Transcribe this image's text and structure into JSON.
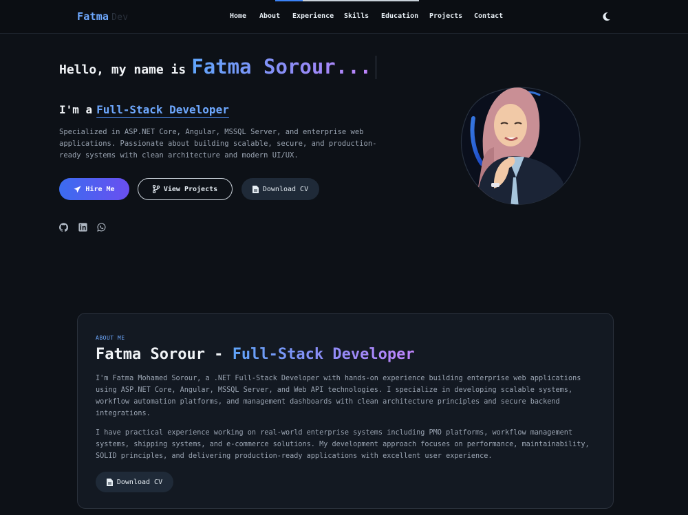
{
  "nav": {
    "logo_main": "Fatma",
    "logo_sub": "Dev",
    "links": [
      "Home",
      "About",
      "Experience",
      "Skills",
      "Education",
      "Projects",
      "Contact"
    ],
    "theme_icon": "moon-icon"
  },
  "hero": {
    "greeting": "Hello, my name is",
    "name": "Fatma Sorour...",
    "role_prefix": "I'm a",
    "role": "Full-Stack Developer",
    "intro": "Specialized in ASP.NET Core, Angular, MSSQL Server, and enterprise web applications. Passionate about building scalable, secure, and production-ready systems with clean architecture and modern UI/UX.",
    "buttons": {
      "hire": "Hire Me",
      "projects": "View Projects",
      "cv": "Download CV"
    },
    "socials": [
      "github-icon",
      "linkedin-icon",
      "whatsapp-icon"
    ]
  },
  "about": {
    "eyebrow": "ABOUT ME",
    "heading_name": "Fatma Sorour - ",
    "heading_role": "Full-Stack Developer",
    "paragraph1": "I'm Fatma Mohamed Sorour, a .NET Full-Stack Developer with hands-on experience building enterprise web applications using ASP.NET Core, Angular, MSSQL Server, and Web API technologies. I specialize in developing scalable systems, workflow automation platforms, and management dashboards with clean architecture principles and secure backend integrations.",
    "paragraph2": "I have practical experience working on real-world enterprise systems including PMO platforms, workflow management systems, shipping systems, and e-commerce solutions. My development approach focuses on performance, maintainability, SOLID principles, and delivering production-ready applications with excellent user experience.",
    "cv_button": "Download CV"
  },
  "colors": {
    "background": "#0d1117",
    "accent_blue": "#60a5fa",
    "accent_purple": "#c084fc",
    "text_muted": "#9aa4b2"
  }
}
